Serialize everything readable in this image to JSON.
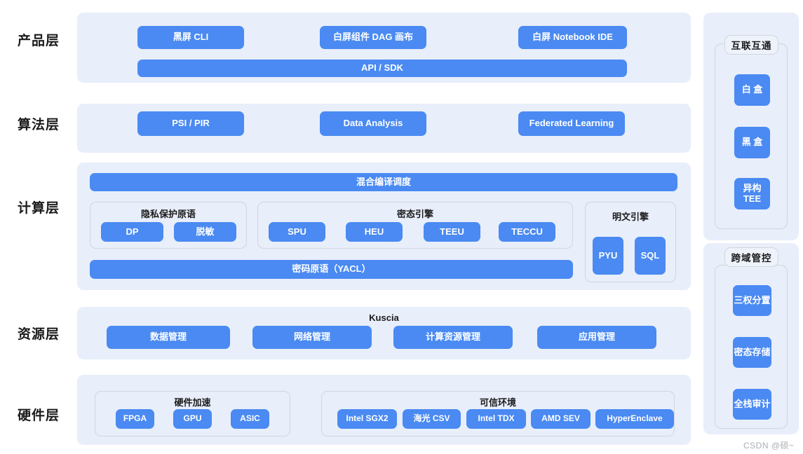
{
  "layers": [
    {
      "id": "product",
      "name": "产品层",
      "items": [
        "黑屏 CLI",
        "白屏组件 DAG 画布",
        "白屏 Notebook IDE"
      ],
      "full_width_item": "API / SDK"
    },
    {
      "id": "algorithm",
      "name": "算法层",
      "items": [
        "PSI / PIR",
        "Data Analysis",
        "Federated Learning"
      ]
    },
    {
      "id": "compute",
      "name": "计算层",
      "top_bar": "混合编译调度",
      "bottom_bar": "密码原语（YACL）",
      "groups": [
        {
          "title": "隐私保护原语",
          "items": [
            "DP",
            "脱敏"
          ]
        },
        {
          "title": "密态引擎",
          "items": [
            "SPU",
            "HEU",
            "TEEU",
            "TECCU"
          ]
        },
        {
          "title": "明文引擎",
          "items": [
            "PYU",
            "SQL"
          ]
        }
      ]
    },
    {
      "id": "resource",
      "name": "资源层",
      "title": "Kuscia",
      "items": [
        "数据管理",
        "网络管理",
        "计算资源管理",
        "应用管理"
      ]
    },
    {
      "id": "hardware",
      "name": "硬件层",
      "groups": [
        {
          "title": "硬件加速",
          "items": [
            "FPGA",
            "GPU",
            "ASIC"
          ]
        },
        {
          "title": "可信环境",
          "items": [
            "Intel SGX2",
            "海光 CSV",
            "Intel TDX",
            "AMD SEV",
            "HyperEnclave"
          ]
        }
      ]
    }
  ],
  "rails": [
    {
      "id": "interop",
      "title": "互联互通",
      "items": [
        "白 盒",
        "黑 盒",
        "异构\nTEE"
      ]
    },
    {
      "id": "crossdomain",
      "title": "跨域管控",
      "items": [
        "三权分置",
        "密态存储",
        "全栈审计"
      ]
    }
  ],
  "watermark": "CSDN @硕~",
  "colors": {
    "accent": "#4a8af2",
    "panel": "#e8eefa",
    "border": "#d2d6dd",
    "text": "#1b1b1b",
    "watermark": "#a9aeb5"
  }
}
